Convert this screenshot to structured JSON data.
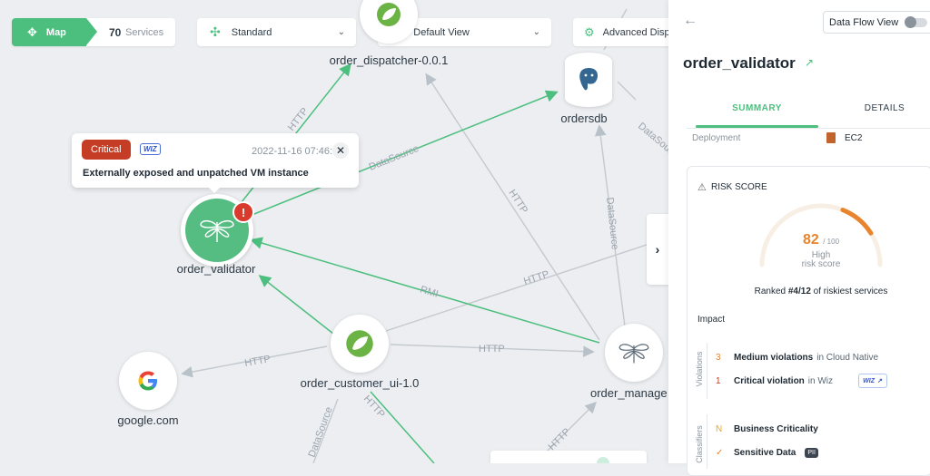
{
  "toolbar": {
    "map_label": "Map",
    "services_count": "70",
    "services_label": "Services",
    "standard_label": "Standard",
    "default_view_label": "Default View",
    "advanced_label": "Advanced Disp"
  },
  "nodes": {
    "dispatcher": "order_dispatcher-0.0.1",
    "ordersdb": "ordersdb",
    "validator": "order_validator",
    "customer_ui": "order_customer_ui-1.0",
    "google": "google.com",
    "manager": "order_manage"
  },
  "edge_labels": {
    "datasource_1": "DataSource",
    "datasource_2": "DataSource",
    "datasource_3": "DataSource",
    "datasource_4": "DataSource",
    "http_1": "HTTP",
    "http_2": "HTTP",
    "http_3": "HTTP",
    "http_4": "HTTP",
    "http_5": "HTTP",
    "http_6": "HTTP",
    "http_7": "HTTP",
    "rmi": "RMI"
  },
  "alert": {
    "severity": "Critical",
    "source_badge": "WIZ",
    "timestamp": "2022-11-16 07:46:11",
    "message": "Externally exposed and unpatched VM instance"
  },
  "panel": {
    "data_flow_label": "Data Flow View",
    "title": "order_validator",
    "tabs": [
      "SUMMARY",
      "DETAILS"
    ],
    "deployment_label": "Deployment",
    "deployment_value": "EC2",
    "risk_title": "RISK SCORE",
    "score": "82",
    "score_max": "/ 100",
    "score_level": "High",
    "score_caption": "risk score",
    "ranked_prefix": "Ranked ",
    "ranked_value": "#4/12",
    "ranked_suffix": " of riskiest services",
    "impact_label": "Impact",
    "violations_group": "Violations",
    "violations": [
      {
        "count": "3",
        "label": "Medium violations",
        "context": "in Cloud Native"
      },
      {
        "count": "1",
        "label": "Critical violation",
        "context": "in Wiz",
        "badge": "WIZ"
      }
    ],
    "classifiers_group": "Classifiers",
    "classifiers": [
      {
        "mark": "N",
        "label": "Business Criticality"
      },
      {
        "mark": "✓",
        "label": "Sensitive Data",
        "badge": "PII"
      }
    ]
  },
  "score_value": 82,
  "colors": {
    "brand_green": "#4cbf7e",
    "critical": "#c53d24",
    "accent_orange": "#e8842d",
    "edge_gray": "#b8c0c8"
  }
}
